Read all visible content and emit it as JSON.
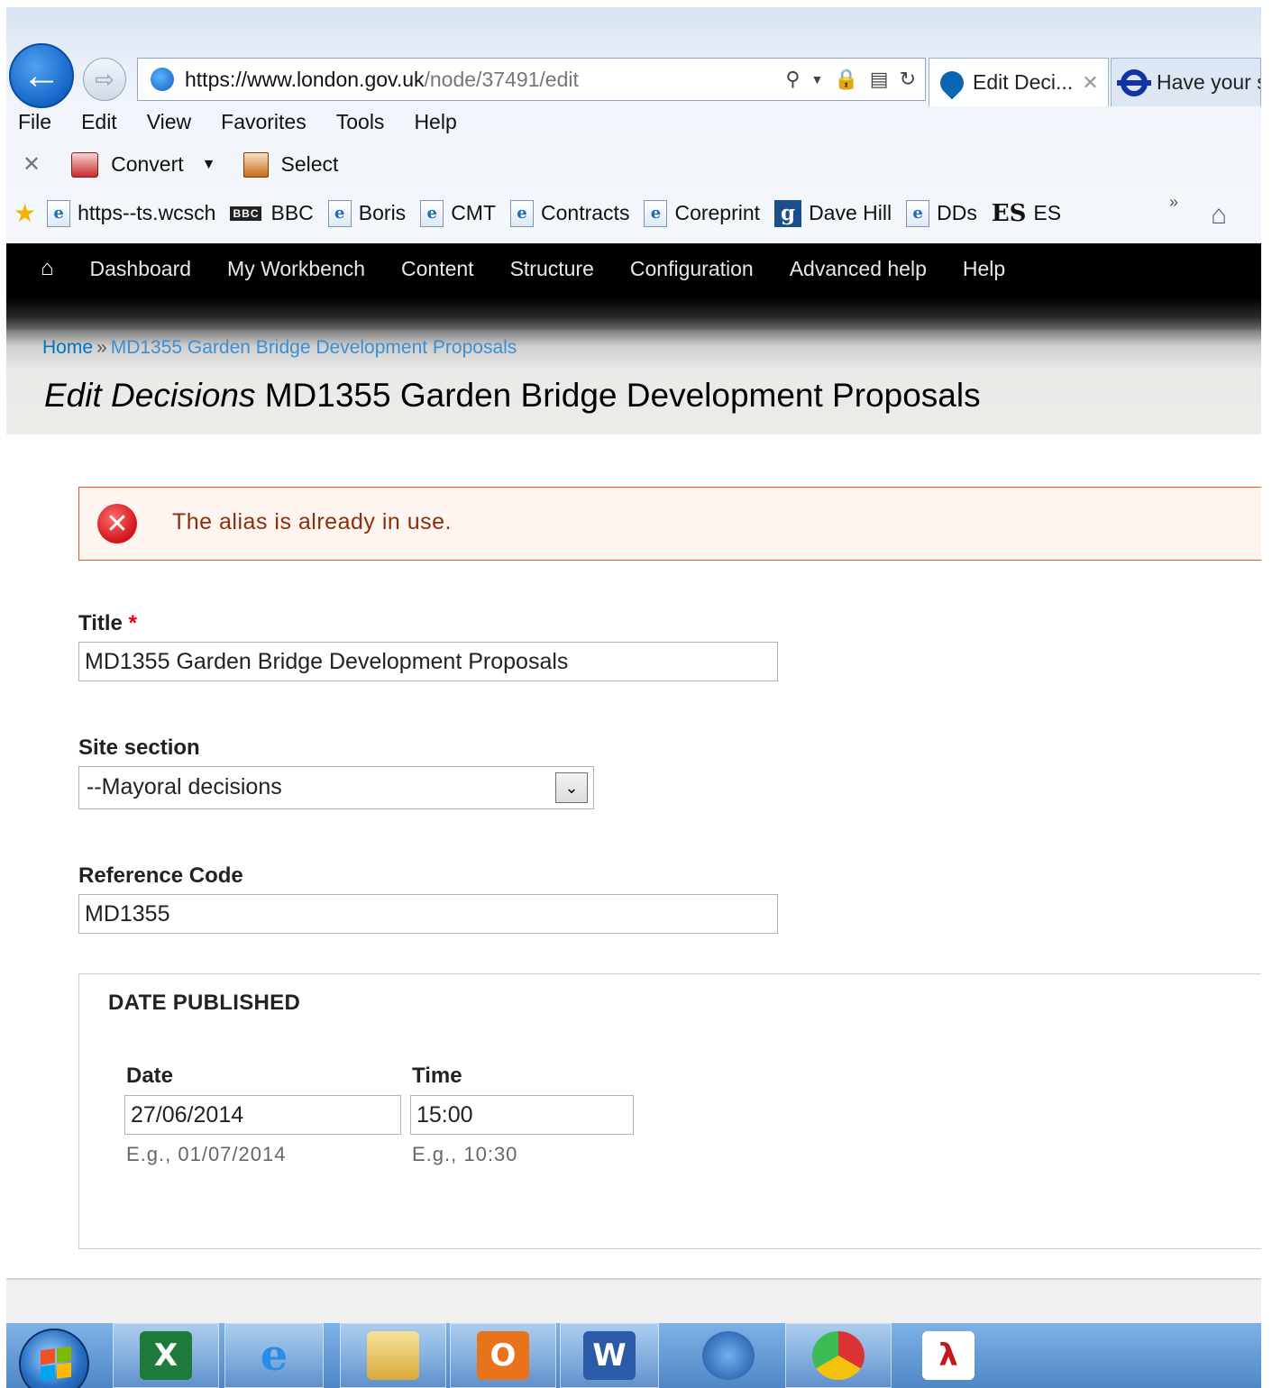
{
  "browser": {
    "url_main": "https://www.london.gov.uk",
    "url_path": "/node/37491/edit",
    "tabs": [
      {
        "label": "Edit Deci...",
        "active": true
      },
      {
        "label": "Have your s",
        "active": false
      }
    ],
    "menu": [
      "File",
      "Edit",
      "View",
      "Favorites",
      "Tools",
      "Help"
    ],
    "commands": {
      "convert": "Convert",
      "select": "Select"
    },
    "favorites": [
      {
        "label": "https--ts.wcsch",
        "icon": "ie-page-icon"
      },
      {
        "label": "BBC",
        "icon": "bbc-icon"
      },
      {
        "label": "Boris",
        "icon": "ie-page-icon"
      },
      {
        "label": "CMT",
        "icon": "ie-page-icon"
      },
      {
        "label": "Contracts",
        "icon": "ie-page-icon"
      },
      {
        "label": "Coreprint",
        "icon": "ie-page-icon"
      },
      {
        "label": "Dave Hill",
        "icon": "guardian-icon"
      },
      {
        "label": "DDs",
        "icon": "ie-page-icon"
      },
      {
        "label": "ES",
        "icon": "es-icon"
      }
    ],
    "overflow_glyph": "»"
  },
  "admin_toolbar": {
    "items": [
      "Dashboard",
      "My Workbench",
      "Content",
      "Structure",
      "Configuration",
      "Advanced help",
      "Help"
    ]
  },
  "page": {
    "breadcrumb": {
      "home": "Home",
      "separator": "»",
      "current": "MD1355 Garden Bridge Development Proposals"
    },
    "title_prefix": "Edit Decisions",
    "title_main": "MD1355 Garden Bridge Development Proposals"
  },
  "messages": {
    "error": "The alias is already in use."
  },
  "form": {
    "title_label": "Title",
    "title_required_marker": "*",
    "title_value": "MD1355 Garden Bridge Development Proposals",
    "site_section_label": "Site section",
    "site_section_value": "--Mayoral decisions",
    "reference_label": "Reference Code",
    "reference_value": "MD1355",
    "date_published": {
      "legend": "DATE PUBLISHED",
      "date_label": "Date",
      "date_value": "27/06/2014",
      "date_hint": "E.g., 01/07/2014",
      "time_label": "Time",
      "time_value": "15:00",
      "time_hint": "E.g., 10:30"
    }
  },
  "taskbar": {
    "apps": [
      "excel-icon",
      "internet-explorer-icon",
      "file-explorer-icon",
      "outlook-icon",
      "word-icon",
      "remote-desktop-icon",
      "chrome-icon",
      "acrobat-icon"
    ]
  },
  "colors": {
    "error_border": "#ed541d",
    "error_bg": "#fef5f1",
    "link": "#0074bd",
    "toolbar_bg": "#000000",
    "required": "#e8000a"
  }
}
